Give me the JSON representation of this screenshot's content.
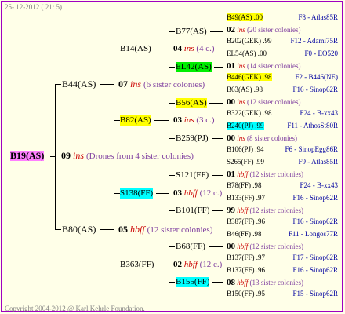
{
  "header": {
    "date": "25- 12-2012 ( 21: 5)"
  },
  "footer": {
    "copyright": "Copyright 2004-2012 @ Karl Kehrle Foundation."
  },
  "root": {
    "name": "B19(AS)",
    "gen": "09",
    "ins": "ins",
    "note": "(Drones from 4 sister colonies)"
  },
  "l1": [
    {
      "name": "B44(AS)",
      "gen": "07",
      "ins": "ins",
      "note": "(6 sister colonies)"
    },
    {
      "name": "B80(AS)",
      "gen": "05",
      "ins": "hbff",
      "note": "(12 sister colonies)"
    }
  ],
  "l2": [
    {
      "name": "B14(AS)",
      "gen": "04",
      "ins": "ins",
      "note": "(4 c.)"
    },
    {
      "name": "B82(AS)",
      "gen": "03",
      "ins": "ins",
      "note": "(3 c.)"
    },
    {
      "name": "S138(FF)",
      "gen": "03",
      "ins": "hbff",
      "note": "(12 c.)"
    },
    {
      "name": "B363(FF)",
      "gen": "02",
      "ins": "hbff",
      "note": "(12 c.)"
    }
  ],
  "l3": [
    "B77(AS)",
    "EL42(AS)",
    "B56(AS)",
    "B259(PJ)",
    "S121(FF)",
    "B101(FF)",
    "B68(FF)",
    "B155(FF)"
  ],
  "l4": [
    {
      "name": "B49(AS) .00",
      "year": "",
      "place": "F8 - Atlas85R"
    },
    {
      "gen": "02",
      "ins": "ins",
      "note": "(20 sister colonies)"
    },
    {
      "name": "B202(GEK) .99",
      "place": "F12 - Adami75R"
    },
    {
      "name": "EL54(AS) .00",
      "place": "F0 - EO520"
    },
    {
      "gen": "01",
      "ins": "ins",
      "note": "(14 sister colonies)"
    },
    {
      "name": "B446(GEK) .98",
      "place": "F2 - B446(NE)"
    },
    {
      "name": "B63(AS) .98",
      "place": "F16 - Sinop62R"
    },
    {
      "gen": "00",
      "ins": "ins",
      "note": "(12 sister colonies)"
    },
    {
      "name": "B322(GEK) .98",
      "place": "F24 - B-xx43"
    },
    {
      "name": "B240(PJ) .99",
      "place": "F11 - AthosSt80R"
    },
    {
      "gen": "00",
      "ins": "ins",
      "note": "(8 sister colonies)"
    },
    {
      "name": "B106(PJ) .94",
      "place": "F6 - SinopEgg86R"
    },
    {
      "name": "S265(FF) .99",
      "place": "F9 - Atlas85R"
    },
    {
      "gen": "01",
      "ins": "hbff",
      "note": "(12 sister colonies)"
    },
    {
      "name": "B78(FF) .98",
      "place": "F24 - B-xx43"
    },
    {
      "name": "B133(FF) .97",
      "place": "F16 - Sinop62R"
    },
    {
      "gen": "99",
      "ins": "hbff",
      "note": "(12 sister colonies)"
    },
    {
      "name": "B387(FF) .96",
      "place": "F16 - Sinop62R"
    },
    {
      "name": "B46(FF) .98",
      "place": "F11 - Longos77R"
    },
    {
      "gen": "00",
      "ins": "hbff",
      "note": "(12 sister colonies)"
    },
    {
      "name": "B137(FF) .97",
      "place": "F17 - Sinop62R"
    },
    {
      "name": "B137(FF) .96",
      "place": "F16 - Sinop62R"
    },
    {
      "gen": "08",
      "ins": "hbff",
      "note": "(13 sister colonies)"
    },
    {
      "name": "B150(FF) .95",
      "place": "F15 - Sinop62R"
    }
  ],
  "colors": {
    "border": "#a000c0",
    "background": "#ffffe8",
    "highlight_yellow": "#ffff00",
    "highlight_cyan": "#00ffff",
    "highlight_green": "#00ee00",
    "highlight_magenta": "#ff80ff",
    "ins_red": "#cc0000",
    "note_purple": "#8040a0",
    "place_blue": "#0000a0"
  }
}
